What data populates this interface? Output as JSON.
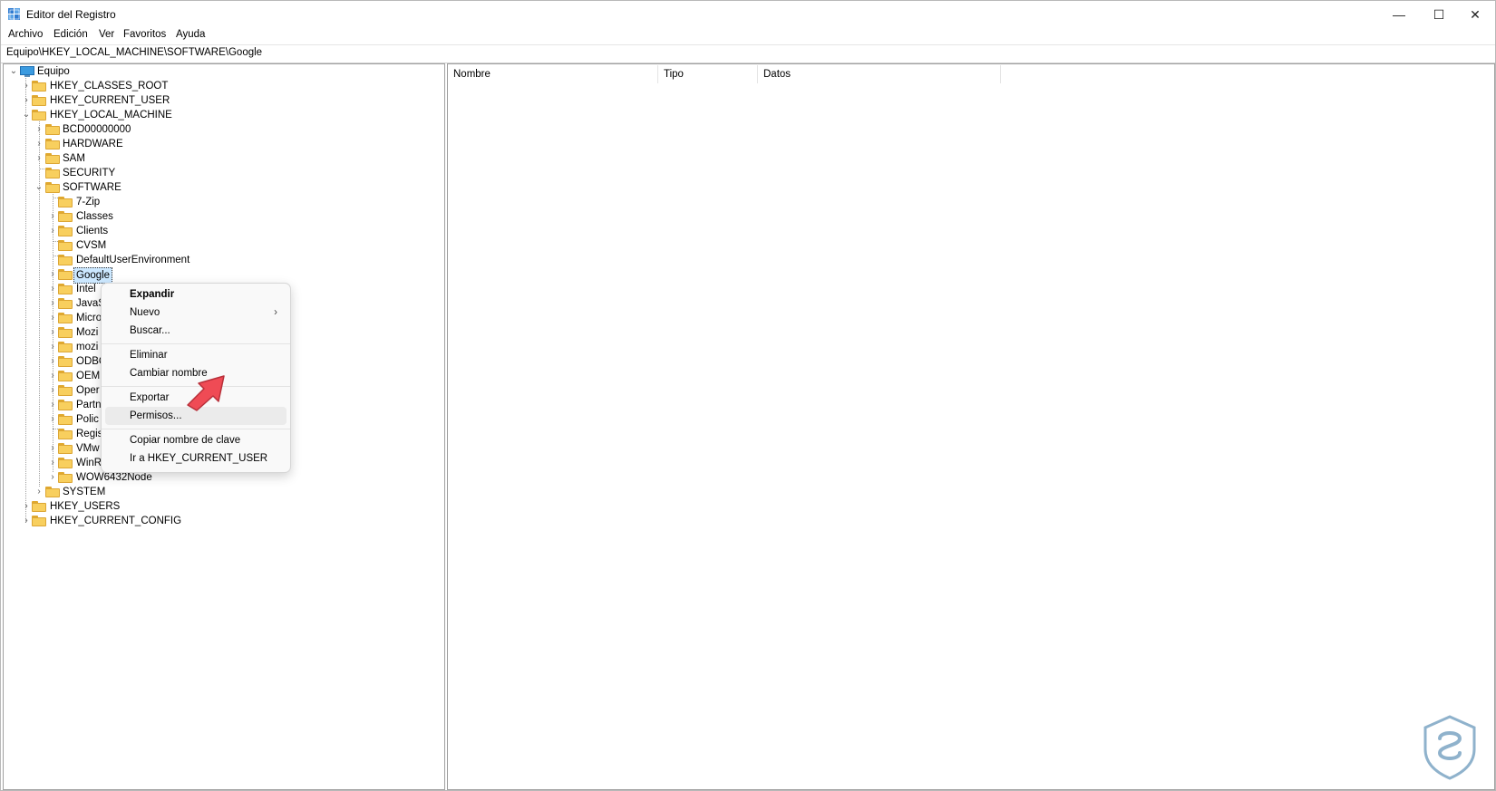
{
  "window": {
    "title": "Editor del Registro",
    "controls": {
      "minimize": "—",
      "maximize": "☐",
      "close": "✕"
    }
  },
  "menubar": [
    "Archivo",
    "Edición",
    "Ver",
    "Favoritos",
    "Ayuda"
  ],
  "address": "Equipo\\HKEY_LOCAL_MACHINE\\SOFTWARE\\Google",
  "tree": {
    "root": "Equipo",
    "hives": [
      "HKEY_CLASSES_ROOT",
      "HKEY_CURRENT_USER",
      "HKEY_LOCAL_MACHINE",
      "HKEY_USERS",
      "HKEY_CURRENT_CONFIG"
    ],
    "hklm_children": [
      "BCD00000000",
      "HARDWARE",
      "SAM",
      "SECURITY",
      "SOFTWARE",
      "SYSTEM"
    ],
    "software_children": [
      "7-Zip",
      "Classes",
      "Clients",
      "CVSM",
      "DefaultUserEnvironment",
      "Google",
      "Intel",
      "JavaS",
      "Micro",
      "Mozi",
      "mozi",
      "ODBC",
      "OEM",
      "Oper",
      "Partn",
      "Polic",
      "Regis",
      "VMw",
      "WinRAR",
      "WOW6432Node"
    ]
  },
  "list": {
    "columns": [
      "Nombre",
      "Tipo",
      "Datos"
    ]
  },
  "context_menu": {
    "groups": [
      [
        "Expandir",
        "Nuevo",
        "Buscar..."
      ],
      [
        "Eliminar",
        "Cambiar nombre"
      ],
      [
        "Exportar",
        "Permisos..."
      ],
      [
        "Copiar nombre de clave",
        "Ir a HKEY_CURRENT_USER"
      ]
    ],
    "highlighted": "Permisos...",
    "submenu_arrow": "›"
  },
  "colors": {
    "accent_arrow": "#ef4b55",
    "selection": "#cce8ff",
    "folder": "#f8cf5e",
    "watermark": "#8fb2cc"
  },
  "icons": {
    "app": "registry-editor-icon",
    "folder": "folder-icon",
    "computer": "computer-icon",
    "watermark": "solvetic-logo"
  }
}
